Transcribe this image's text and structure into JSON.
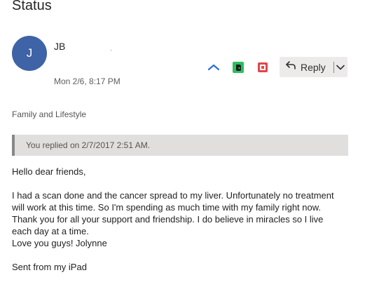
{
  "message": {
    "subject": "Status",
    "avatar_initial": "J",
    "sender": "JB",
    "sender_trailing": ".",
    "date": "Mon 2/6, 8:17 PM",
    "category": "Family and Lifestyle",
    "replied_notice": "You replied on 2/7/2017 2:51 AM.",
    "body": {
      "greeting": "Hello dear friends,",
      "para1": [
        "I had a scan done and the cancer spread to my liver. Unfortunately no treatment",
        "will work at this time. So I'm spending as much time with my family right now.",
        "Thank you for all your support and friendship. I do believe in miracles so I live",
        "each day at a time.",
        "Love you guys! Jolynne"
      ],
      "signature": "Sent from my iPad"
    }
  },
  "actions": {
    "reply_label": "Reply",
    "icons": [
      "onenote-like-up-chevron-icon",
      "evernote-icon",
      "app-red-icon",
      "reply-arrow-icon",
      "chevron-down-icon"
    ]
  },
  "colors": {
    "avatar_bg": "#3e63a6",
    "evernote_green": "#2dbe60",
    "red_icon": "#e0474c",
    "blue_icon": "#2b6fd6"
  }
}
